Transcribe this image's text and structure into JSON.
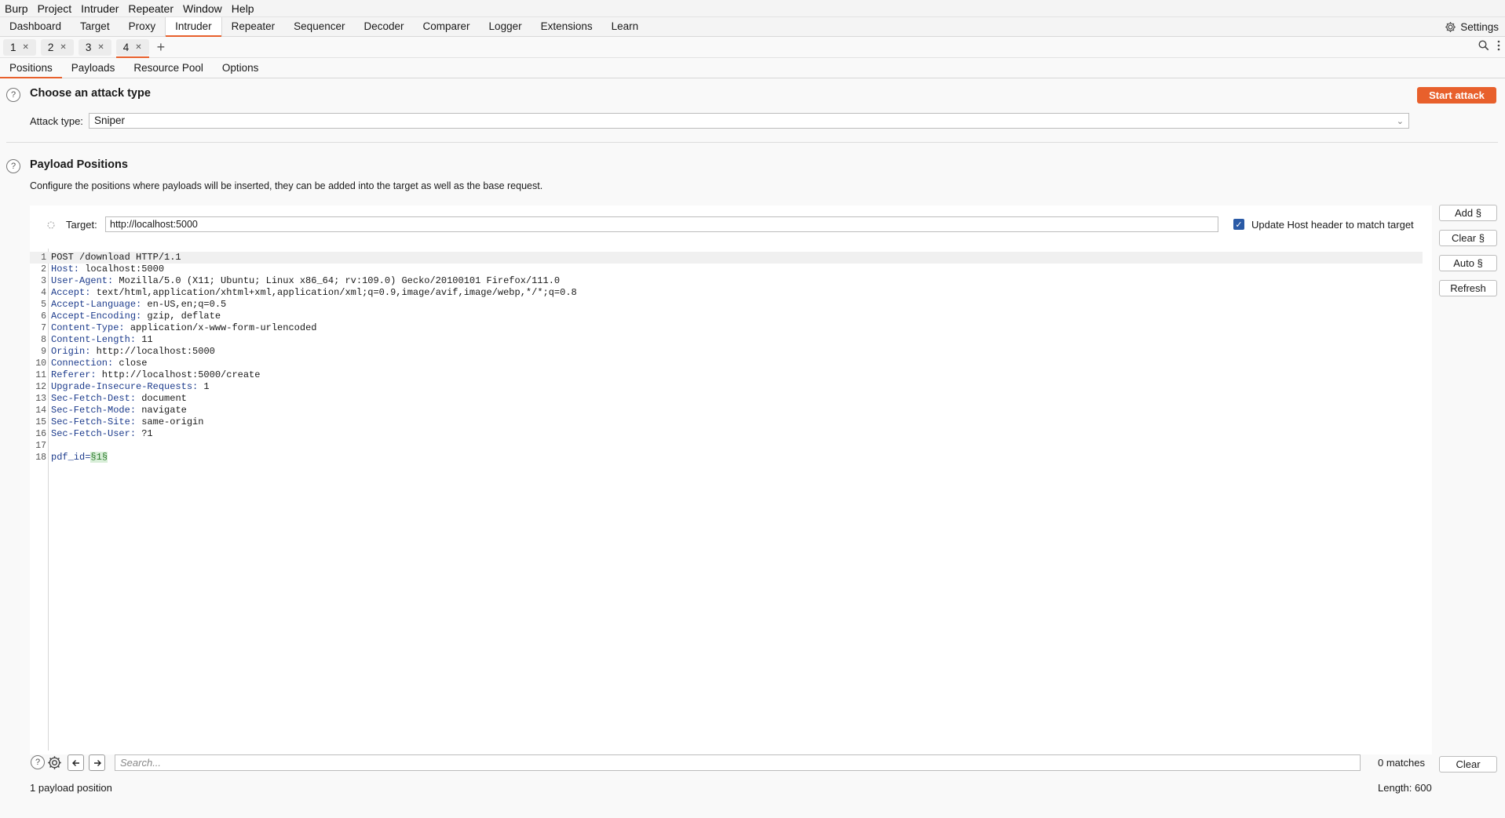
{
  "menu": [
    "Burp",
    "Project",
    "Intruder",
    "Repeater",
    "Window",
    "Help"
  ],
  "main_tabs": [
    "Dashboard",
    "Target",
    "Proxy",
    "Intruder",
    "Repeater",
    "Sequencer",
    "Decoder",
    "Comparer",
    "Logger",
    "Extensions",
    "Learn"
  ],
  "settings_label": "Settings",
  "sub_tabs": [
    "1",
    "2",
    "3",
    "4"
  ],
  "intruder_tabs": [
    "Positions",
    "Payloads",
    "Resource Pool",
    "Options"
  ],
  "attack": {
    "title": "Choose an attack type",
    "start_label": "Start attack",
    "type_label": "Attack type:",
    "type_value": "Sniper"
  },
  "positions": {
    "title": "Payload Positions",
    "description": "Configure the positions where payloads will be inserted, they can be added into the target as well as the base request.",
    "target_label": "Target:",
    "target_value": "http://localhost:5000",
    "update_host_label": "Update Host header to match target",
    "buttons": [
      "Add §",
      "Clear §",
      "Auto §",
      "Refresh"
    ]
  },
  "request_lines": [
    {
      "n": "1",
      "k": "POST /download HTTP/1.1",
      "v": ""
    },
    {
      "n": "2",
      "k": "Host:",
      "v": " localhost:5000"
    },
    {
      "n": "3",
      "k": "User-Agent:",
      "v": " Mozilla/5.0 (X11; Ubuntu; Linux x86_64; rv:109.0) Gecko/20100101 Firefox/111.0"
    },
    {
      "n": "4",
      "k": "Accept:",
      "v": " text/html,application/xhtml+xml,application/xml;q=0.9,image/avif,image/webp,*/*;q=0.8"
    },
    {
      "n": "5",
      "k": "Accept-Language:",
      "v": " en-US,en;q=0.5"
    },
    {
      "n": "6",
      "k": "Accept-Encoding:",
      "v": " gzip, deflate"
    },
    {
      "n": "7",
      "k": "Content-Type:",
      "v": " application/x-www-form-urlencoded"
    },
    {
      "n": "8",
      "k": "Content-Length:",
      "v": " 11"
    },
    {
      "n": "9",
      "k": "Origin:",
      "v": " http://localhost:5000"
    },
    {
      "n": "10",
      "k": "Connection:",
      "v": " close"
    },
    {
      "n": "11",
      "k": "Referer:",
      "v": " http://localhost:5000/create"
    },
    {
      "n": "12",
      "k": "Upgrade-Insecure-Requests:",
      "v": " 1"
    },
    {
      "n": "13",
      "k": "Sec-Fetch-Dest:",
      "v": " document"
    },
    {
      "n": "14",
      "k": "Sec-Fetch-Mode:",
      "v": " navigate"
    },
    {
      "n": "15",
      "k": "Sec-Fetch-Site:",
      "v": " same-origin"
    },
    {
      "n": "16",
      "k": "Sec-Fetch-User:",
      "v": " ?1"
    },
    {
      "n": "17",
      "k": "",
      "v": ""
    },
    {
      "n": "18",
      "k": "pdf_id=",
      "v": "§1§"
    }
  ],
  "search": {
    "placeholder": "Search...",
    "matches": "0 matches",
    "clear_label": "Clear"
  },
  "footer": {
    "positions_count": "1 payload position",
    "length": "Length: 600"
  },
  "colors": {
    "accent": "#e8602c",
    "checkbox": "#2a5aa6"
  }
}
